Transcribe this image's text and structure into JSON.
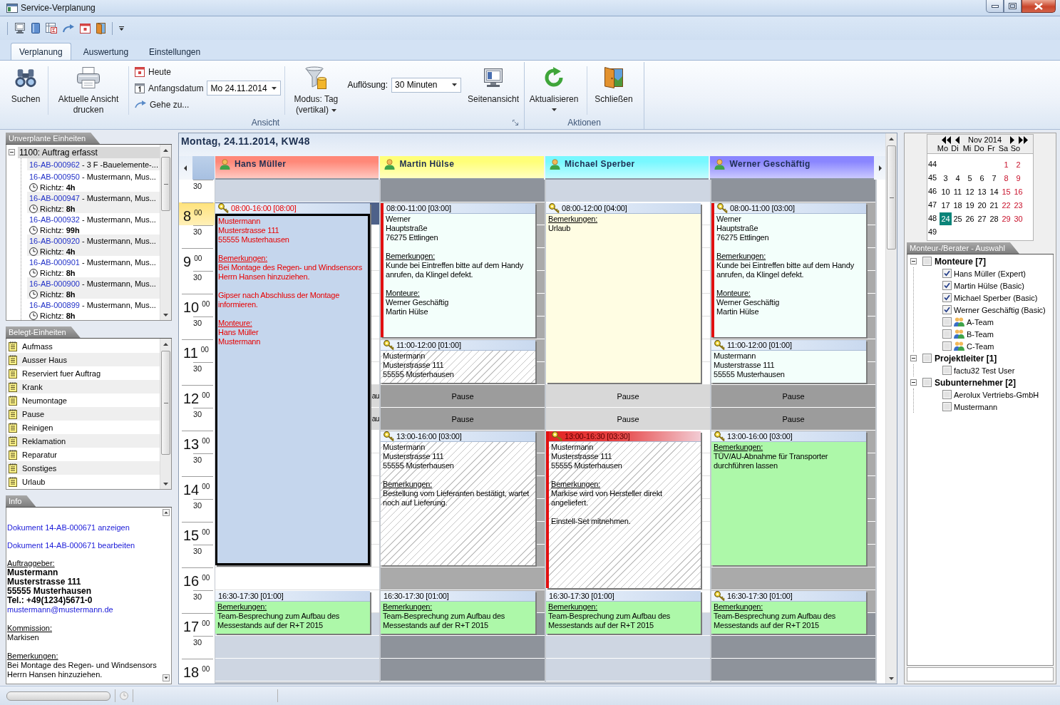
{
  "window": {
    "title": "Service-Verplanung"
  },
  "ribbon": {
    "tabs": [
      {
        "label": "Verplanung",
        "selected": true
      },
      {
        "label": "Auswertung",
        "selected": false
      },
      {
        "label": "Einstellungen",
        "selected": false
      }
    ],
    "view_group": {
      "label": "Ansicht",
      "search": "Suchen",
      "print": "Aktuelle Ansicht drucken",
      "today": "Heute",
      "start_date": {
        "label": "Anfangsdatum",
        "value": "Mo 24.11.2014"
      },
      "goto": "Gehe zu...",
      "mode": "Modus: Tag (vertikal)",
      "resolution": {
        "label": "Auflösung:",
        "value": "30 Minuten"
      },
      "page_view": "Seitenansicht"
    },
    "actions_group": {
      "label": "Aktionen",
      "refresh": "Aktualisieren",
      "close": "Schließen"
    }
  },
  "unplanned": {
    "title": "Unverplante Einheiten",
    "groups": [
      {
        "label": "1100: Auftrag erfasst",
        "expanded": true,
        "children": [
          {
            "number": "16-AB-000962",
            "text": "- 3 F -Bauelemente-..."
          },
          {
            "number": "16-AB-000950",
            "text": "- Mustermann, Mus...",
            "estimate": "Richtz: **4h**"
          },
          {
            "number": "16-AB-000947",
            "text": "- Mustermann, Mus...",
            "estimate": "Richtz: **8h**"
          },
          {
            "number": "16-AB-000932",
            "text": "- Mustermann, Mus...",
            "estimate": "Richtz: **99h**"
          },
          {
            "number": "16-AB-000920",
            "text": "- Mustermann, Mus...",
            "estimate": "Richtz: **4h**"
          },
          {
            "number": "16-AB-000901",
            "text": "- Mustermann, Mus...",
            "estimate": "Richtz: **8h**"
          },
          {
            "number": "16-AB-000900",
            "text": "- Mustermann, Mus...",
            "estimate": "Richtz: **8h**"
          },
          {
            "number": "16-AB-000899",
            "text": "- Mustermann, Mus...",
            "estimate": "Richtz: **8h**"
          }
        ]
      }
    ]
  },
  "booked_units": {
    "title": "Belegt-Einheiten",
    "items": [
      "Aufmass",
      "Ausser Haus",
      "Reserviert fuer Auftrag",
      "Krank",
      "Neumontage",
      "Pause",
      "Reinigen",
      "Reklamation",
      "Reparatur",
      "Sonstiges",
      "Urlaub"
    ]
  },
  "info": {
    "title": "Info",
    "links": [
      "Dokument 14-AB-000671 anzeigen",
      "Dokument 14-AB-000671 bearbeiten"
    ],
    "client": {
      "heading": "Auftraggeber:",
      "lines": [
        "Mustermann",
        "Musterstrasse 111",
        "55555 Musterhausen",
        "Tel.: +49(1234)5671-0"
      ],
      "email": "mustermann@mustermann.de"
    },
    "commission": {
      "heading": "Kommission:",
      "lines": [
        "Markisen"
      ]
    },
    "remarks": {
      "heading": "Bemerkungen:",
      "lines": [
        "Bei Montage des Regen- und Windsensors Herrn Hansen hinzuziehen."
      ]
    }
  },
  "calendar": {
    "date_title": "Montag, 24.11.2014, KW48",
    "times": [
      {
        "kind": "half",
        "label": "30",
        "selected": false
      },
      {
        "kind": "hour",
        "label": "8$^{00}$",
        "selected": true
      },
      {
        "kind": "half",
        "label": "30",
        "selected": false
      },
      {
        "kind": "hour",
        "label": "9$^{00}$",
        "selected": false
      },
      {
        "kind": "half",
        "label": "30",
        "selected": false
      },
      {
        "kind": "hour",
        "label": "10$^{00}$",
        "selected": false
      },
      {
        "kind": "half",
        "label": "30",
        "selected": false
      },
      {
        "kind": "hour",
        "label": "11$^{00}$",
        "selected": false
      },
      {
        "kind": "half",
        "label": "30",
        "selected": false
      },
      {
        "kind": "hour",
        "label": "12$^{00}$",
        "selected": false
      },
      {
        "kind": "half",
        "label": "30",
        "selected": false
      },
      {
        "kind": "hour",
        "label": "13$^{00}$",
        "selected": false
      },
      {
        "kind": "half",
        "label": "30",
        "selected": false
      },
      {
        "kind": "hour",
        "label": "14$^{00}$",
        "selected": false
      },
      {
        "kind": "half",
        "label": "30",
        "selected": false
      },
      {
        "kind": "hour",
        "label": "15$^{00}$",
        "selected": false
      },
      {
        "kind": "half",
        "label": "30",
        "selected": false
      },
      {
        "kind": "hour",
        "label": "16$^{00}$",
        "selected": false
      },
      {
        "kind": "half",
        "label": "30",
        "selected": false
      },
      {
        "kind": "hour",
        "label": "17$^{00}$",
        "selected": false
      },
      {
        "kind": "half",
        "label": "30",
        "selected": false
      },
      {
        "kind": "hour",
        "label": "18$^{00}$",
        "selected": false
      }
    ],
    "resources": [
      {
        "name": "Hans Müller",
        "color": "#ff8878",
        "shaded": false,
        "slots": [
          {
            "kind": "off"
          },
          {
            "kind": "booked"
          },
          {
            "kind": "free"
          },
          {
            "kind": "free"
          },
          {
            "kind": "free"
          },
          {
            "kind": "free"
          },
          {
            "kind": "free"
          },
          {
            "kind": "free"
          },
          {
            "kind": "free"
          },
          {
            "kind": "pause",
            "label": "au"
          },
          {
            "kind": "pause",
            "label": "au"
          },
          {
            "kind": "free"
          },
          {
            "kind": "free"
          },
          {
            "kind": "free"
          },
          {
            "kind": "free"
          },
          {
            "kind": "free"
          },
          {
            "kind": "free"
          },
          {
            "kind": "free"
          },
          {
            "kind": "free"
          },
          {
            "kind": "off"
          },
          {
            "kind": "off"
          },
          {
            "kind": "off"
          }
        ],
        "appointments": [
          {
            "time": "08:00-16:00 [08:00]",
            "icon": true,
            "flagged": false,
            "alert": false,
            "selected": true,
            "hatched": false,
            "color": "#c5d6ed",
            "sections": [
              {
                "lines": [
                  "Mustermann",
                  "Musterstrasse 111",
                  "55555 Musterhausen"
                ]
              },
              {
                "heading": "Bemerkungen:",
                "lines": [
                  "Bei Montage des Regen- und Windsensors Herrn Hansen hinzuziehen."
                ]
              },
              {
                "lines": [
                  "Gipser nach Abschluss der Montage informieren."
                ]
              },
              {
                "heading": "Monteure:",
                "lines": [
                  "Hans Müller",
                  "Mustermann"
                ]
              }
            ]
          },
          {
            "time": "16:30-17:30 [01:00]",
            "icon": false,
            "flagged": false,
            "alert": false,
            "selected": false,
            "hatched": false,
            "color": "#adf8a9",
            "sections": [
              {
                "heading": "Bemerkungen:",
                "lines": [
                  "Team-Besprechung zum Aufbau des Messestands auf der R+T 2015"
                ]
              }
            ]
          }
        ]
      },
      {
        "name": "Martin Hülse",
        "color": "#ffff78",
        "shaded": true,
        "slots": [
          {
            "kind": "off"
          },
          {
            "kind": "busy"
          },
          {
            "kind": "busy"
          },
          {
            "kind": "busy"
          },
          {
            "kind": "busy"
          },
          {
            "kind": "busy"
          },
          {
            "kind": "busy"
          },
          {
            "kind": "busy"
          },
          {
            "kind": "busy"
          },
          {
            "kind": "pause",
            "label": "Pause"
          },
          {
            "kind": "pause",
            "label": "Pause"
          },
          {
            "kind": "busy"
          },
          {
            "kind": "busy"
          },
          {
            "kind": "busy"
          },
          {
            "kind": "busy"
          },
          {
            "kind": "busy"
          },
          {
            "kind": "busy"
          },
          {
            "kind": "busy"
          },
          {
            "kind": "busy"
          },
          {
            "kind": "off"
          },
          {
            "kind": "off"
          },
          {
            "kind": "off"
          }
        ],
        "appointments": [
          {
            "time": "08:00-11:00 [03:00]",
            "icon": false,
            "flagged": true,
            "alert": false,
            "selected": false,
            "hatched": false,
            "color": "#f3fffb",
            "sections": [
              {
                "lines": [
                  "Werner",
                  "Hauptstraße",
                  "76275 Ettlingen"
                ]
              },
              {
                "heading": "Bemerkungen:",
                "lines": [
                  "Kunde bei Eintreffen bitte auf dem Handy anrufen, da Klingel defekt."
                ]
              },
              {
                "heading": "Monteure:",
                "lines": [
                  "Werner Geschäftig",
                  "Martin Hülse"
                ]
              }
            ]
          },
          {
            "time": "11:00-12:00 [01:00]",
            "icon": true,
            "flagged": false,
            "alert": false,
            "selected": false,
            "hatched": true,
            "color": "#ffffff",
            "sections": [
              {
                "lines": [
                  "Mustermann",
                  "Musterstrasse 111",
                  "55555 Musterhausen"
                ]
              }
            ]
          },
          {
            "time": "13:00-16:00 [03:00]",
            "icon": true,
            "flagged": false,
            "alert": false,
            "selected": false,
            "hatched": true,
            "color": "#ffffff",
            "sections": [
              {
                "lines": [
                  "Mustermann",
                  "Musterstrasse 111",
                  "55555 Musterhausen"
                ]
              },
              {
                "heading": "Bemerkungen:",
                "lines": [
                  "Bestellung vom Lieferanten bestätigt, wartet noch auf Lieferung."
                ]
              }
            ]
          },
          {
            "time": "16:30-17:30 [01:00]",
            "icon": false,
            "flagged": false,
            "alert": false,
            "selected": false,
            "hatched": false,
            "color": "#adf8a9",
            "sections": [
              {
                "heading": "Bemerkungen:",
                "lines": [
                  "Team-Besprechung zum Aufbau des Messestands auf der R+T 2015"
                ]
              }
            ]
          }
        ]
      },
      {
        "name": "Michael Sperber",
        "color": "#78f8ff",
        "shaded": false,
        "slots": [
          {
            "kind": "off"
          },
          {
            "kind": "free"
          },
          {
            "kind": "free"
          },
          {
            "kind": "free"
          },
          {
            "kind": "free"
          },
          {
            "kind": "free"
          },
          {
            "kind": "free"
          },
          {
            "kind": "free"
          },
          {
            "kind": "free"
          },
          {
            "kind": "pause",
            "label": "Pause"
          },
          {
            "kind": "pause",
            "label": "Pause"
          },
          {
            "kind": "free"
          },
          {
            "kind": "free"
          },
          {
            "kind": "free"
          },
          {
            "kind": "free"
          },
          {
            "kind": "free"
          },
          {
            "kind": "free"
          },
          {
            "kind": "free"
          },
          {
            "kind": "free"
          },
          {
            "kind": "off"
          },
          {
            "kind": "off"
          },
          {
            "kind": "off"
          }
        ],
        "appointments": [
          {
            "time": "08:00-12:00 [04:00]",
            "icon": true,
            "flagged": false,
            "alert": false,
            "selected": false,
            "hatched": false,
            "color": "#fffde3",
            "sections": [
              {
                "heading": "Bemerkungen:",
                "lines": [
                  "Urlaub"
                ]
              }
            ]
          },
          {
            "time": "13:00-16:30 [03:30]",
            "icon": true,
            "flagged": true,
            "alert": true,
            "selected": false,
            "hatched": true,
            "color": "#ffffff",
            "sections": [
              {
                "lines": [
                  "Mustermann",
                  "Musterstrasse 111",
                  "55555 Musterhausen"
                ]
              },
              {
                "heading": "Bemerkungen:",
                "lines": [
                  "Markise wird von Hersteller direkt angeliefert."
                ]
              },
              {
                "lines": [
                  "Einstell-Set mitnehmen."
                ]
              }
            ]
          },
          {
            "time": "16:30-17:30 [01:00]",
            "icon": false,
            "flagged": false,
            "alert": false,
            "selected": false,
            "hatched": false,
            "color": "#adf8a9",
            "sections": [
              {
                "heading": "Bemerkungen:",
                "lines": [
                  "Team-Besprechung zum Aufbau des Messestands auf der R+T 2015"
                ]
              }
            ]
          }
        ]
      },
      {
        "name": "Werner Geschäftig",
        "color": "#8a86ff",
        "shaded": true,
        "slots": [
          {
            "kind": "off"
          },
          {
            "kind": "busy"
          },
          {
            "kind": "busy"
          },
          {
            "kind": "busy"
          },
          {
            "kind": "busy"
          },
          {
            "kind": "busy"
          },
          {
            "kind": "busy"
          },
          {
            "kind": "busy"
          },
          {
            "kind": "busy"
          },
          {
            "kind": "pause",
            "label": "Pause"
          },
          {
            "kind": "pause",
            "label": "Pause"
          },
          {
            "kind": "busy"
          },
          {
            "kind": "busy"
          },
          {
            "kind": "busy"
          },
          {
            "kind": "busy"
          },
          {
            "kind": "busy"
          },
          {
            "kind": "busy"
          },
          {
            "kind": "busy"
          },
          {
            "kind": "busy"
          },
          {
            "kind": "off"
          },
          {
            "kind": "off"
          },
          {
            "kind": "off"
          }
        ],
        "appointments": [
          {
            "time": "08:00-11:00 [03:00]",
            "icon": true,
            "flagged": true,
            "alert": false,
            "selected": false,
            "hatched": false,
            "color": "#f3fffb",
            "sections": [
              {
                "lines": [
                  "Werner",
                  "Hauptstraße",
                  "76275 Ettlingen"
                ]
              },
              {
                "heading": "Bemerkungen:",
                "lines": [
                  "Kunde bei Eintreffen bitte auf dem Handy anrufen, da Klingel defekt."
                ]
              },
              {
                "heading": "Monteure:",
                "lines": [
                  "Werner Geschäftig",
                  "Martin Hülse"
                ]
              }
            ]
          },
          {
            "time": "11:00-12:00 [01:00]",
            "icon": true,
            "flagged": false,
            "alert": false,
            "selected": false,
            "hatched": false,
            "color": "#f3fffb",
            "sections": [
              {
                "lines": [
                  "Mustermann",
                  "Musterstrasse 111",
                  "55555 Musterhausen"
                ]
              }
            ]
          },
          {
            "time": "13:00-16:00 [03:00]",
            "icon": true,
            "flagged": false,
            "alert": false,
            "selected": false,
            "hatched": false,
            "color": "#adf8a9",
            "sections": [
              {
                "heading": "Bemerkungen:",
                "lines": [
                  "TÜV/AU-Abnahme für Transporter durchführen lassen"
                ]
              }
            ]
          },
          {
            "time": "16:30-17:30 [01:00]",
            "icon": true,
            "flagged": false,
            "alert": false,
            "selected": false,
            "hatched": false,
            "color": "#adf8a9",
            "sections": [
              {
                "heading": "Bemerkungen:",
                "lines": [
                  "Team-Besprechung zum Aufbau des Messestands auf der R+T 2015"
                ]
              }
            ]
          }
        ]
      }
    ]
  },
  "mini_calendar": {
    "month": "Nov 2014",
    "weekdays": [
      "Mo",
      "Di",
      "Mi",
      "Do",
      "Fr",
      "Sa",
      "So"
    ],
    "weeks": [
      {
        "number": "44",
        "days": [
          {
            "label": "1",
            "weekend": true,
            "selected": false
          },
          {
            "label": "2",
            "weekend": true,
            "selected": false
          }
        ]
      },
      {
        "number": "45",
        "days": [
          {
            "label": "3",
            "weekend": false,
            "selected": false
          },
          {
            "label": "4",
            "weekend": false,
            "selected": false
          },
          {
            "label": "5",
            "weekend": false,
            "selected": false
          },
          {
            "label": "6",
            "weekend": false,
            "selected": false
          },
          {
            "label": "7",
            "weekend": false,
            "selected": false
          },
          {
            "label": "8",
            "weekend": true,
            "selected": false
          },
          {
            "label": "9",
            "weekend": true,
            "selected": false
          }
        ]
      },
      {
        "number": "46",
        "days": [
          {
            "label": "10",
            "weekend": false,
            "selected": false
          },
          {
            "label": "11",
            "weekend": false,
            "selected": false
          },
          {
            "label": "12",
            "weekend": false,
            "selected": false
          },
          {
            "label": "13",
            "weekend": false,
            "selected": false
          },
          {
            "label": "14",
            "weekend": false,
            "selected": false
          },
          {
            "label": "15",
            "weekend": true,
            "selected": false
          },
          {
            "label": "16",
            "weekend": true,
            "selected": false
          }
        ]
      },
      {
        "number": "47",
        "days": [
          {
            "label": "17",
            "weekend": false,
            "selected": false
          },
          {
            "label": "18",
            "weekend": false,
            "selected": false
          },
          {
            "label": "19",
            "weekend": false,
            "selected": false
          },
          {
            "label": "20",
            "weekend": false,
            "selected": false
          },
          {
            "label": "21",
            "weekend": false,
            "selected": false
          },
          {
            "label": "22",
            "weekend": true,
            "selected": false
          },
          {
            "label": "23",
            "weekend": true,
            "selected": false
          }
        ]
      },
      {
        "number": "48",
        "days": [
          {
            "label": "24",
            "weekend": false,
            "selected": true
          },
          {
            "label": "25",
            "weekend": false,
            "selected": false
          },
          {
            "label": "26",
            "weekend": false,
            "selected": false
          },
          {
            "label": "27",
            "weekend": false,
            "selected": false
          },
          {
            "label": "28",
            "weekend": false,
            "selected": false
          },
          {
            "label": "29",
            "weekend": true,
            "selected": false
          },
          {
            "label": "30",
            "weekend": true,
            "selected": false
          }
        ]
      },
      {
        "number": "49"
      }
    ]
  },
  "resource_picker": {
    "title": "Monteur-/Berater - Auswahl",
    "groups": [
      {
        "label": "Monteure [7]",
        "expanded": true,
        "checked": false,
        "children": [
          {
            "label": "Hans Müller (Expert)",
            "kind": "person",
            "checked": true
          },
          {
            "label": "Martin Hülse (Basic)",
            "kind": "person",
            "checked": true
          },
          {
            "label": "Michael Sperber (Basic)",
            "kind": "person",
            "checked": true
          },
          {
            "label": "Werner Geschäftig (Basic)",
            "kind": "person",
            "checked": true
          },
          {
            "label": "A-Team",
            "kind": "team",
            "checked": false
          },
          {
            "label": "B-Team",
            "kind": "team",
            "checked": false
          },
          {
            "label": "C-Team",
            "kind": "team",
            "checked": false
          }
        ]
      },
      {
        "label": "Projektleiter [1]",
        "expanded": true,
        "checked": false,
        "children": [
          {
            "label": "factu32 Test User",
            "kind": "person",
            "checked": false
          }
        ]
      },
      {
        "label": "Subunternehmer [2]",
        "expanded": true,
        "checked": false,
        "children": [
          {
            "label": "Aerolux Vertriebs-GmbH",
            "kind": "person",
            "checked": false
          },
          {
            "label": "Mustermann",
            "kind": "person",
            "checked": false
          }
        ]
      }
    ]
  },
  "status_bar": {
    "progress": {
      "level": 0
    }
  }
}
